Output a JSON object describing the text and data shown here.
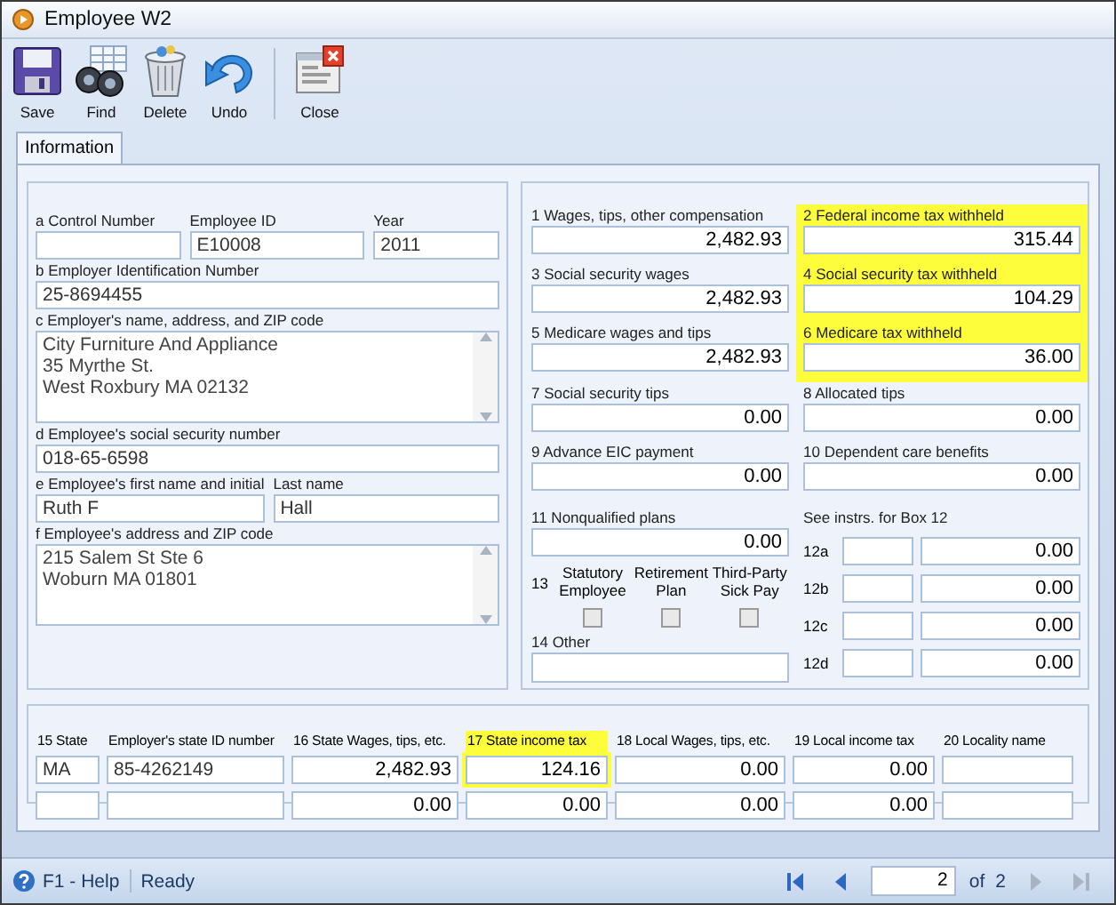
{
  "window": {
    "title": "Employee W2"
  },
  "toolbar": [
    {
      "kind": "save",
      "label": "Save"
    },
    {
      "kind": "find",
      "label": "Find"
    },
    {
      "kind": "delete",
      "label": "Delete"
    },
    {
      "kind": "undo",
      "label": "Undo"
    },
    {
      "kind": "close",
      "label": "Close"
    }
  ],
  "tabs": [
    {
      "label": "Information",
      "selected": true
    }
  ],
  "employer_section": {
    "lines": [
      {
        "fields": [
          {
            "label": "a  Control Number",
            "kind": "text"
          },
          {
            "label": "Employee ID",
            "value": "E10008",
            "kind": "text"
          },
          {
            "label": "Year",
            "value": "2011",
            "kind": "text"
          }
        ]
      },
      {
        "fields": [
          {
            "label": "b  Employer Identification Number",
            "value": "25-8694455",
            "kind": "text"
          }
        ]
      },
      {
        "fields": [
          {
            "label": "c  Employer's name, address, and ZIP code",
            "value": "City Furniture And Appliance\n35 Myrthe St.\nWest Roxbury MA 02132",
            "kind": "memo"
          }
        ]
      },
      {
        "fields": [
          {
            "label": "d  Employee's social security number",
            "value": "018-65-6598",
            "kind": "text"
          }
        ]
      },
      {
        "fields": [
          {
            "label": "e  Employee's first name and initial",
            "value": "Ruth F",
            "kind": "text"
          },
          {
            "label": "Last name",
            "value": "Hall",
            "kind": "text"
          }
        ]
      },
      {
        "fields": [
          {
            "label": "f  Employee's address and ZIP code",
            "value": "215 Salem St Ste 6\nWoburn MA 01801",
            "kind": "memo"
          }
        ]
      }
    ]
  },
  "wage_rows": [
    {
      "boxes": [
        {
          "label": "1  Wages, tips, other compensation",
          "value": "2,482.93",
          "highlighted": false
        },
        {
          "label": "2  Federal income tax withheld",
          "value": "315.44",
          "highlighted": true
        }
      ]
    },
    {
      "boxes": [
        {
          "label": "3  Social security wages",
          "value": "2,482.93",
          "highlighted": false
        },
        {
          "label": "4  Social security tax withheld",
          "value": "104.29",
          "highlighted": true
        }
      ]
    },
    {
      "boxes": [
        {
          "label": "5  Medicare wages and tips",
          "value": "2,482.93",
          "highlighted": false
        },
        {
          "label": "6  Medicare tax withheld",
          "value": "36.00",
          "highlighted": true
        }
      ]
    },
    {
      "boxes": [
        {
          "label": "7  Social security tips",
          "value": "0.00",
          "highlighted": false
        },
        {
          "label": "8  Allocated tips",
          "value": "0.00",
          "highlighted": false
        }
      ]
    },
    {
      "boxes": [
        {
          "label": "9  Advance EIC payment",
          "value": "0.00",
          "highlighted": false
        },
        {
          "label": "10  Dependent care benefits",
          "value": "0.00",
          "highlighted": false
        }
      ]
    }
  ],
  "box_11": {
    "label": "11  Nonqualified plans",
    "value": "0.00"
  },
  "box_13": {
    "number": "13",
    "options": [
      {
        "label": "Statutory Employee",
        "checked": false
      },
      {
        "label": "Retirement Plan",
        "checked": false
      },
      {
        "label": "Third-Party Sick Pay",
        "checked": false
      }
    ]
  },
  "box_14": {
    "label": "14  Other"
  },
  "box_12": {
    "label": "See instrs. for Box 12",
    "rows": [
      {
        "code_label": "12a",
        "amount": "0.00"
      },
      {
        "code_label": "12b",
        "amount": "0.00"
      },
      {
        "code_label": "12c",
        "amount": "0.00"
      },
      {
        "code_label": "12d",
        "amount": "0.00"
      }
    ]
  },
  "state_table": {
    "columns": [
      {
        "label": "15  State",
        "kind": "text"
      },
      {
        "label": "Employer's state ID number",
        "kind": "text"
      },
      {
        "label": "16  State Wages, tips, etc.",
        "kind": "amount"
      },
      {
        "label": "17  State income tax",
        "kind": "amount"
      },
      {
        "label": "18  Local Wages, tips, etc.",
        "kind": "amount"
      },
      {
        "label": "19  Local income tax",
        "kind": "amount"
      },
      {
        "label": "20  Locality name",
        "kind": "text"
      }
    ],
    "header_highlights": [
      false,
      false,
      false,
      true,
      false,
      false,
      false
    ],
    "rows": [
      {
        "cells": [
          {
            "value": "MA",
            "highlighted": false
          },
          {
            "value": "85-4262149",
            "highlighted": false
          },
          {
            "value": "2,482.93",
            "highlighted": false
          },
          {
            "value": "124.16",
            "highlighted": true
          },
          {
            "value": "0.00",
            "highlighted": false
          },
          {
            "value": "0.00",
            "highlighted": false
          },
          {
            "highlighted": false
          }
        ]
      },
      {
        "cells": [
          {
            "highlighted": false
          },
          {
            "highlighted": false
          },
          {
            "value": "0.00",
            "highlighted": false
          },
          {
            "value": "0.00",
            "highlighted": false
          },
          {
            "value": "0.00",
            "highlighted": false
          },
          {
            "value": "0.00",
            "highlighted": false
          },
          {
            "highlighted": false
          }
        ]
      }
    ]
  },
  "status_bar": {
    "help": "F1 - Help",
    "status": "Ready",
    "page": "2",
    "of_label": "of",
    "total": "2",
    "nav": [
      {
        "kind": "first",
        "disabled": false
      },
      {
        "kind": "prev",
        "disabled": false
      },
      {
        "kind": "next",
        "disabled": true
      },
      {
        "kind": "last",
        "disabled": true
      }
    ]
  }
}
